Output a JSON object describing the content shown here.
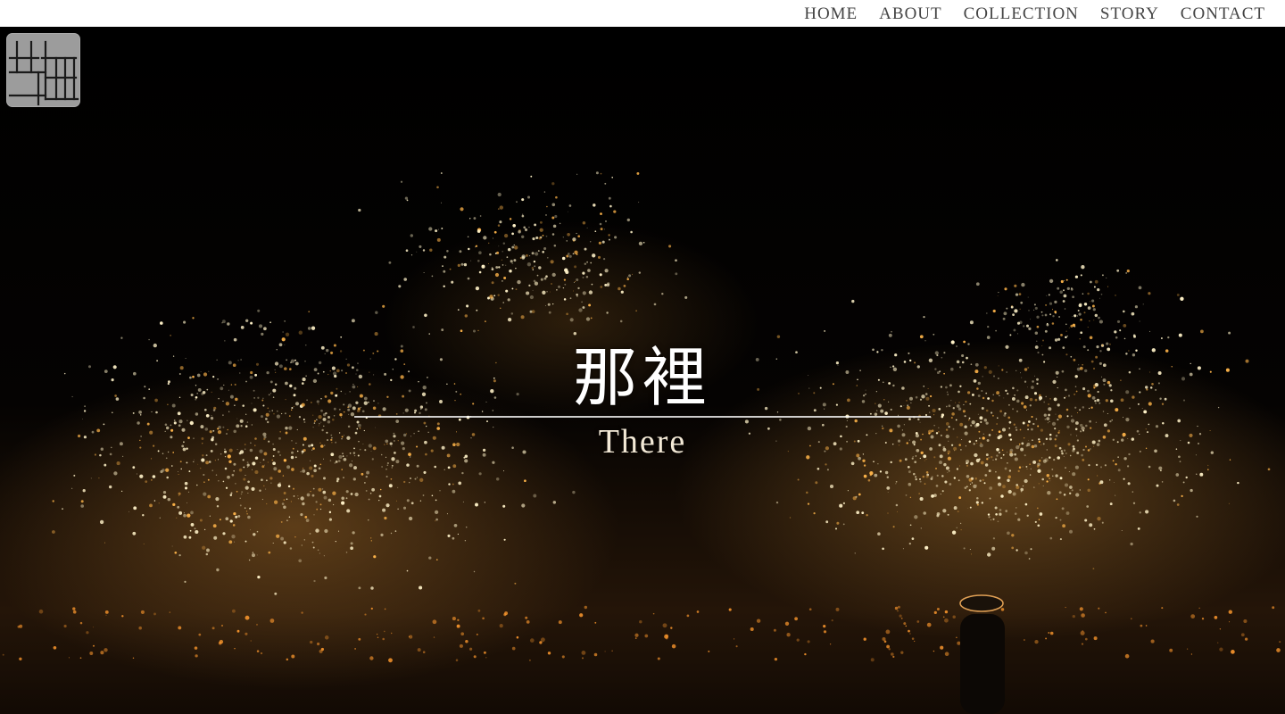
{
  "nav": {
    "items": [
      {
        "label": "HOME"
      },
      {
        "label": "ABOUT"
      },
      {
        "label": "COLLECTION"
      },
      {
        "label": "STORY"
      },
      {
        "label": "CONTACT"
      }
    ]
  },
  "hero": {
    "title": "那裡",
    "subtitle": "There"
  },
  "colors": {
    "topbar": "#ffffff",
    "nav_text": "#444444",
    "logo_bg": "#9c9c9c",
    "spark": "#ffd98a"
  }
}
